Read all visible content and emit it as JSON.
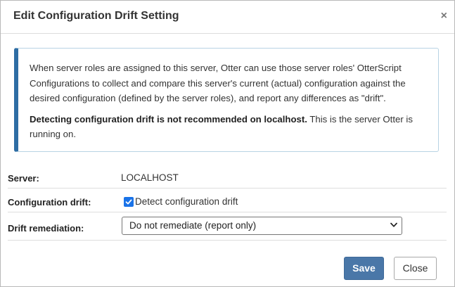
{
  "dialog": {
    "title": "Edit Configuration Drift Setting",
    "close_symbol": "×"
  },
  "info": {
    "paragraph1": "When server roles are assigned to this server, Otter can use those server roles' OtterScript Configurations to collect and compare this server's current (actual) configuration against the desired configuration (defined by the server roles), and report any differences as \"drift\".",
    "warning_bold": "Detecting configuration drift is not recommended on localhost.",
    "warning_rest": " This is the server Otter is running on.",
    "accent_color": "#2e6da4"
  },
  "form": {
    "server_label": "Server:",
    "server_value": "LOCALHOST",
    "drift_label": "Configuration drift:",
    "drift_checkbox_label": "Detect configuration drift",
    "drift_checked": true,
    "remediation_label": "Drift remediation:",
    "remediation_selected": "Do not remediate (report only)"
  },
  "buttons": {
    "save": "Save",
    "close": "Close",
    "save_color": "#4a77a8"
  },
  "icons": {
    "close": "close-icon",
    "checkmark": "checkmark-icon",
    "chevron": "chevron-down-icon"
  }
}
